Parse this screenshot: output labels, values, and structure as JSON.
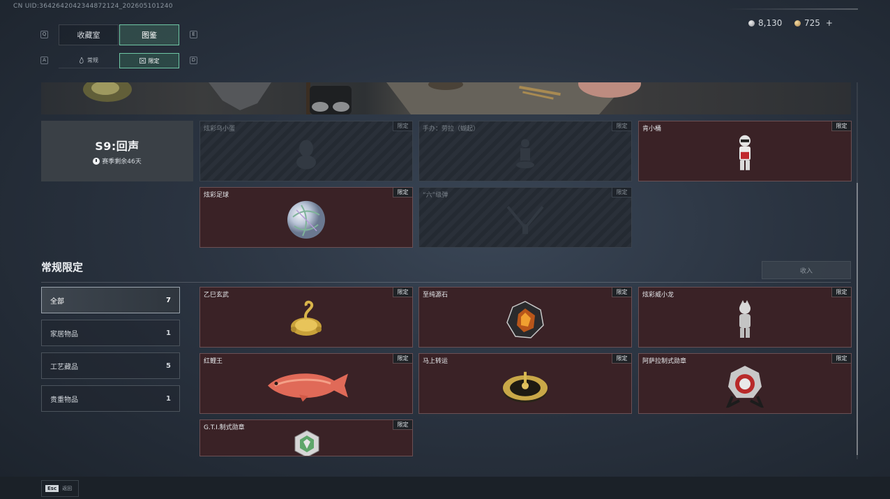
{
  "uid": "CN UID:3642642042344872124_202605101240",
  "currency": {
    "silver": "8,130",
    "gold": "725",
    "plus": "+"
  },
  "tabs": {
    "key_left": "Q",
    "key_right": "E",
    "items": [
      {
        "label": "收藏室"
      },
      {
        "label": "图鉴"
      }
    ],
    "sub_key_left": "A",
    "sub_key_right": "D",
    "sub_items": [
      {
        "label": "常规"
      },
      {
        "label": "限定"
      }
    ]
  },
  "season": {
    "title": "S9:回声",
    "subtitle": "赛季剩余46天"
  },
  "season_items": [
    {
      "name": "炫彩乌小蛋",
      "tag": "限定",
      "locked": true
    },
    {
      "name": "手办：劳拉（蝴起）",
      "tag": "限定",
      "locked": true
    },
    {
      "name": "肯小桶",
      "tag": "限定",
      "locked": false
    },
    {
      "name": "炫彩足球",
      "tag": "限定",
      "locked": false
    },
    {
      "name": "“六”级弹",
      "tag": "限定",
      "locked": true
    }
  ],
  "section": {
    "title": "常规限定",
    "collapse_label": "收入"
  },
  "filters": [
    {
      "label": "全部",
      "count": "7"
    },
    {
      "label": "家居物品",
      "count": "1"
    },
    {
      "label": "工艺藏品",
      "count": "5"
    },
    {
      "label": "贵重物品",
      "count": "1"
    }
  ],
  "regular_items": [
    {
      "name": "乙巳玄武",
      "tag": "限定"
    },
    {
      "name": "至纯源石",
      "tag": "限定"
    },
    {
      "name": "炫彩威小龙",
      "tag": "限定"
    },
    {
      "name": "红鲤王",
      "tag": "限定"
    },
    {
      "name": "马上转运",
      "tag": "限定"
    },
    {
      "name": "阿萨拉制式勋章",
      "tag": "限定"
    },
    {
      "name": "G.T.I.制式勋章",
      "tag": "限定"
    }
  ],
  "footer": {
    "esc_key": "Esc",
    "esc_label": "返回"
  }
}
